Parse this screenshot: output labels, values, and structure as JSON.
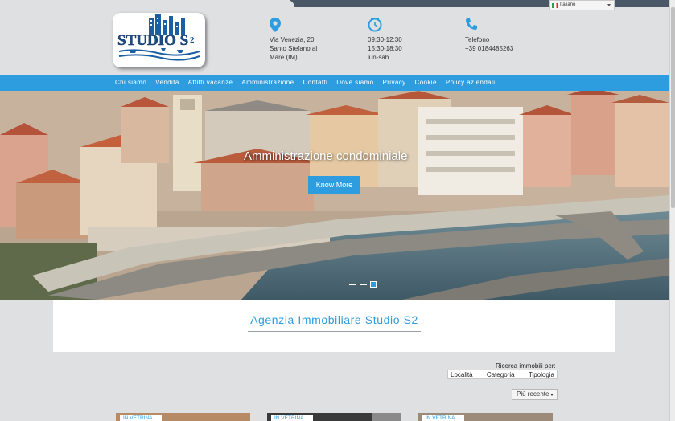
{
  "language": {
    "selected": "Italiano"
  },
  "logo": {
    "text": "STUDIO S",
    "superscript": "2"
  },
  "contacts": {
    "address": {
      "icon": "map-pin-icon",
      "lines": [
        "Via Venezia, 20",
        "Santo Stefano al",
        "Mare (IM)"
      ]
    },
    "hours": {
      "icon": "clock-icon",
      "lines": [
        "09:30-12:30",
        "15:30-18:30",
        "lun-sab"
      ]
    },
    "phone": {
      "icon": "phone-icon",
      "lines": [
        "Telefono",
        "+39 0184485263"
      ]
    }
  },
  "nav": {
    "items": [
      "Chi siamo",
      "Vendita",
      "Affitti vacanze",
      "Amministrazione",
      "Contatti",
      "Dove siamo",
      "Privacy",
      "Cookie",
      "Policy aziendali"
    ]
  },
  "hero": {
    "title": "Amministrazione condominiale",
    "button": "Know More",
    "slides": 3,
    "active_slide": 3
  },
  "intro": {
    "title": "Agenzia Immobiliare Studio S2"
  },
  "search": {
    "label": "Ricerca immobili per:",
    "tabs": [
      "Località",
      "Categoria",
      "Tipologia"
    ]
  },
  "sort": {
    "selected": "Più recente"
  },
  "listings": [
    {
      "badge": "IN VETRINA"
    },
    {
      "badge": "IN VETRINA"
    },
    {
      "badge": "IN VETRINA"
    }
  ],
  "colors": {
    "accent": "#2d9de0",
    "topbar": "#4a5766",
    "page_bg": "#dfe0e2"
  }
}
